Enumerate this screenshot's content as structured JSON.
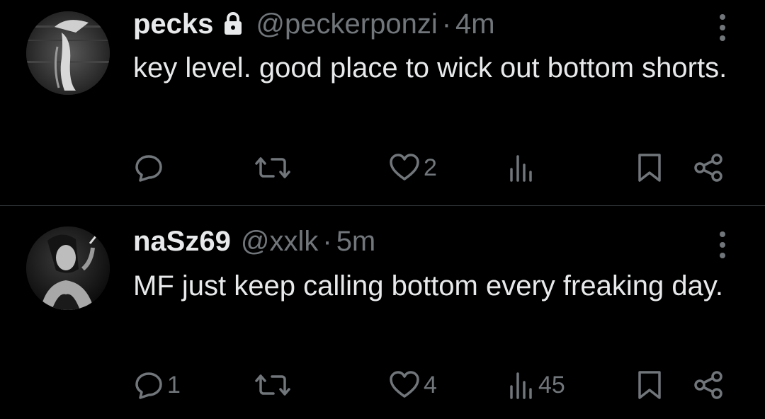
{
  "tweets": [
    {
      "display_name": "pecks",
      "handle": "@peckerponzi",
      "separator": "·",
      "time": "4m",
      "protected": true,
      "text": "key level. good place to wick out bottom shorts.",
      "replies": "",
      "retweets": "",
      "likes": "2",
      "views": ""
    },
    {
      "display_name": "naSz69",
      "handle": "@xxlk",
      "separator": "·",
      "time": "5m",
      "protected": false,
      "text": "MF just keep calling bottom every freaking day.",
      "replies": "1",
      "retweets": "",
      "likes": "4",
      "views": "45"
    }
  ],
  "theme": {
    "background": "#000000",
    "text": "#e7e9ea",
    "secondary": "#71767b",
    "divider": "#2f3336"
  },
  "icons": [
    "lock-icon",
    "more-icon",
    "reply-icon",
    "retweet-icon",
    "like-icon",
    "views-icon",
    "bookmark-icon",
    "share-icon"
  ]
}
